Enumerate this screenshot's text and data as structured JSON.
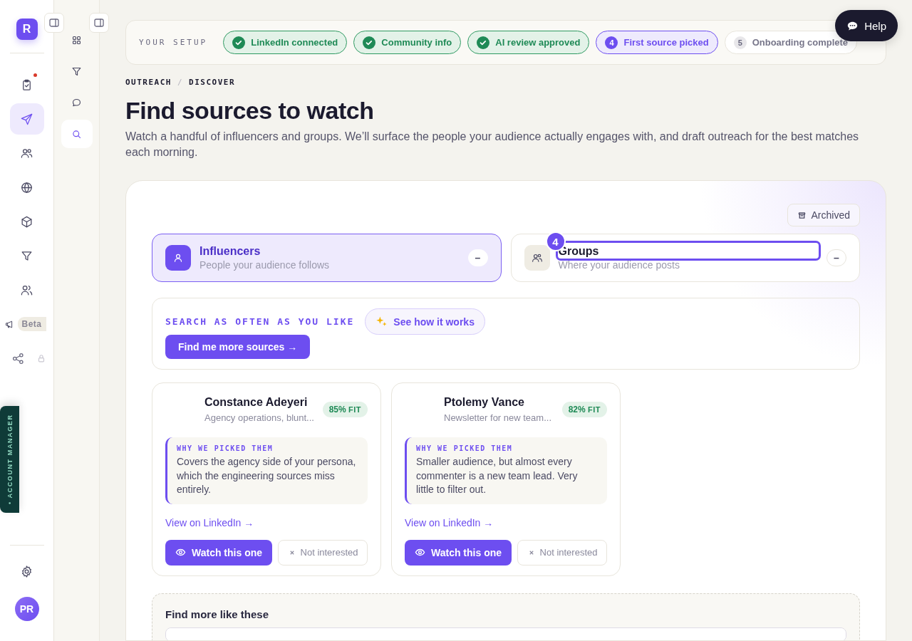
{
  "rail": {
    "logo": "R",
    "items": [
      {
        "selected": false,
        "notification": true,
        "locked": false
      },
      {
        "selected": true,
        "notification": false,
        "locked": false
      },
      {
        "selected": false,
        "notification": false,
        "locked": false
      },
      {
        "selected": false,
        "notification": false,
        "locked": false
      },
      {
        "selected": false,
        "notification": false,
        "locked": false
      },
      {
        "selected": false,
        "notification": false,
        "locked": false
      },
      {
        "selected": false,
        "notification": false,
        "locked": false
      },
      {
        "selected": false,
        "notification": false,
        "locked": false,
        "badge": "Beta"
      },
      {
        "selected": false,
        "notification": false,
        "locked": true
      }
    ],
    "avatar": "PR"
  },
  "subnav": {
    "items": [
      {
        "selected": false
      },
      {
        "selected": false
      },
      {
        "selected": false
      },
      {
        "selected": true
      }
    ]
  },
  "account_manager_tab": {
    "label": "• ACCOUNT MANAGER"
  },
  "help_button": {
    "label": "Help"
  },
  "setup": {
    "label": "YOUR SETUP",
    "steps": [
      {
        "label": "LinkedIn connected",
        "completed": true,
        "selected": false
      },
      {
        "label": "Community info",
        "completed": true,
        "selected": false
      },
      {
        "label": "AI review approved",
        "completed": true,
        "selected": false
      },
      {
        "label": "First source picked",
        "completed": false,
        "selected": true,
        "number": "4"
      },
      {
        "label": "Onboarding complete",
        "completed": false,
        "selected": false,
        "number": "5"
      }
    ]
  },
  "breadcrumb": {
    "items": [
      "OUTREACH",
      "DISCOVER"
    ],
    "separator": "/"
  },
  "title": "Find sources to watch",
  "subtitle": "Watch a handful of influencers and groups. We’ll surface the people your audience actually engages with, and draft outreach for the best matches each morning.",
  "archived_button": "Archived",
  "segments": [
    {
      "title": "Influencers",
      "subtitle": "People your audience follows",
      "selected": true,
      "toggle": "–"
    },
    {
      "title": "Groups",
      "subtitle": "Where your audience posts",
      "selected": false,
      "toggle": "–",
      "tour_badge": "4"
    }
  ],
  "search_panel": {
    "eyebrow": "SEARCH AS OFTEN AS YOU LIKE",
    "how_link": "See how it works",
    "button": "Find me more sources →"
  },
  "cards": [
    {
      "name": "Constance Adeyeri",
      "description": "Agency operations, blunt...",
      "fit": "85%",
      "fit_suffix": "FIT",
      "note_label": "WHY WE PICKED THEM",
      "note": "Covers the agency side of your persona, which the engineering sources miss entirely.",
      "link": "View on LinkedIn →",
      "watch": "Watch this one",
      "dismiss": "Not interested"
    },
    {
      "name": "Ptolemy Vance",
      "description": "Newsletter for new team...",
      "fit": "82%",
      "fit_suffix": "FIT",
      "note_label": "WHY WE PICKED THEM",
      "note": "Smaller audience, but almost every commenter is a new team lead. Very little to filter out.",
      "link": "View on LinkedIn →",
      "watch": "Watch this one",
      "dismiss": "Not interested"
    }
  ],
  "find_more": {
    "title": "Find more like these"
  }
}
